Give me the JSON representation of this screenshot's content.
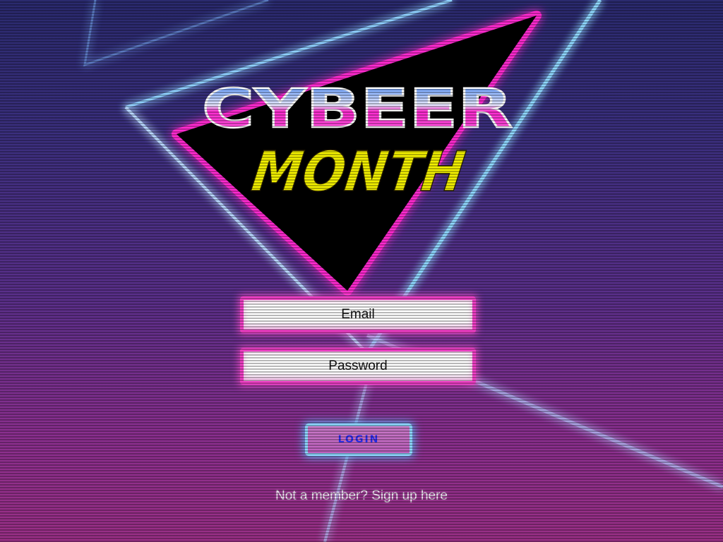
{
  "logo": {
    "line1": "CYBEER",
    "line2": "MONTH"
  },
  "form": {
    "email_placeholder": "Email",
    "password_placeholder": "Password",
    "login_label": "LOGIN"
  },
  "footer": {
    "signup_text": "Not a member? Sign up here"
  },
  "colors": {
    "neon_pink": "#f240c8",
    "neon_blue": "#8fd8ff",
    "logo_yellow": "#f2f000",
    "login_text": "#2a2ef0"
  }
}
